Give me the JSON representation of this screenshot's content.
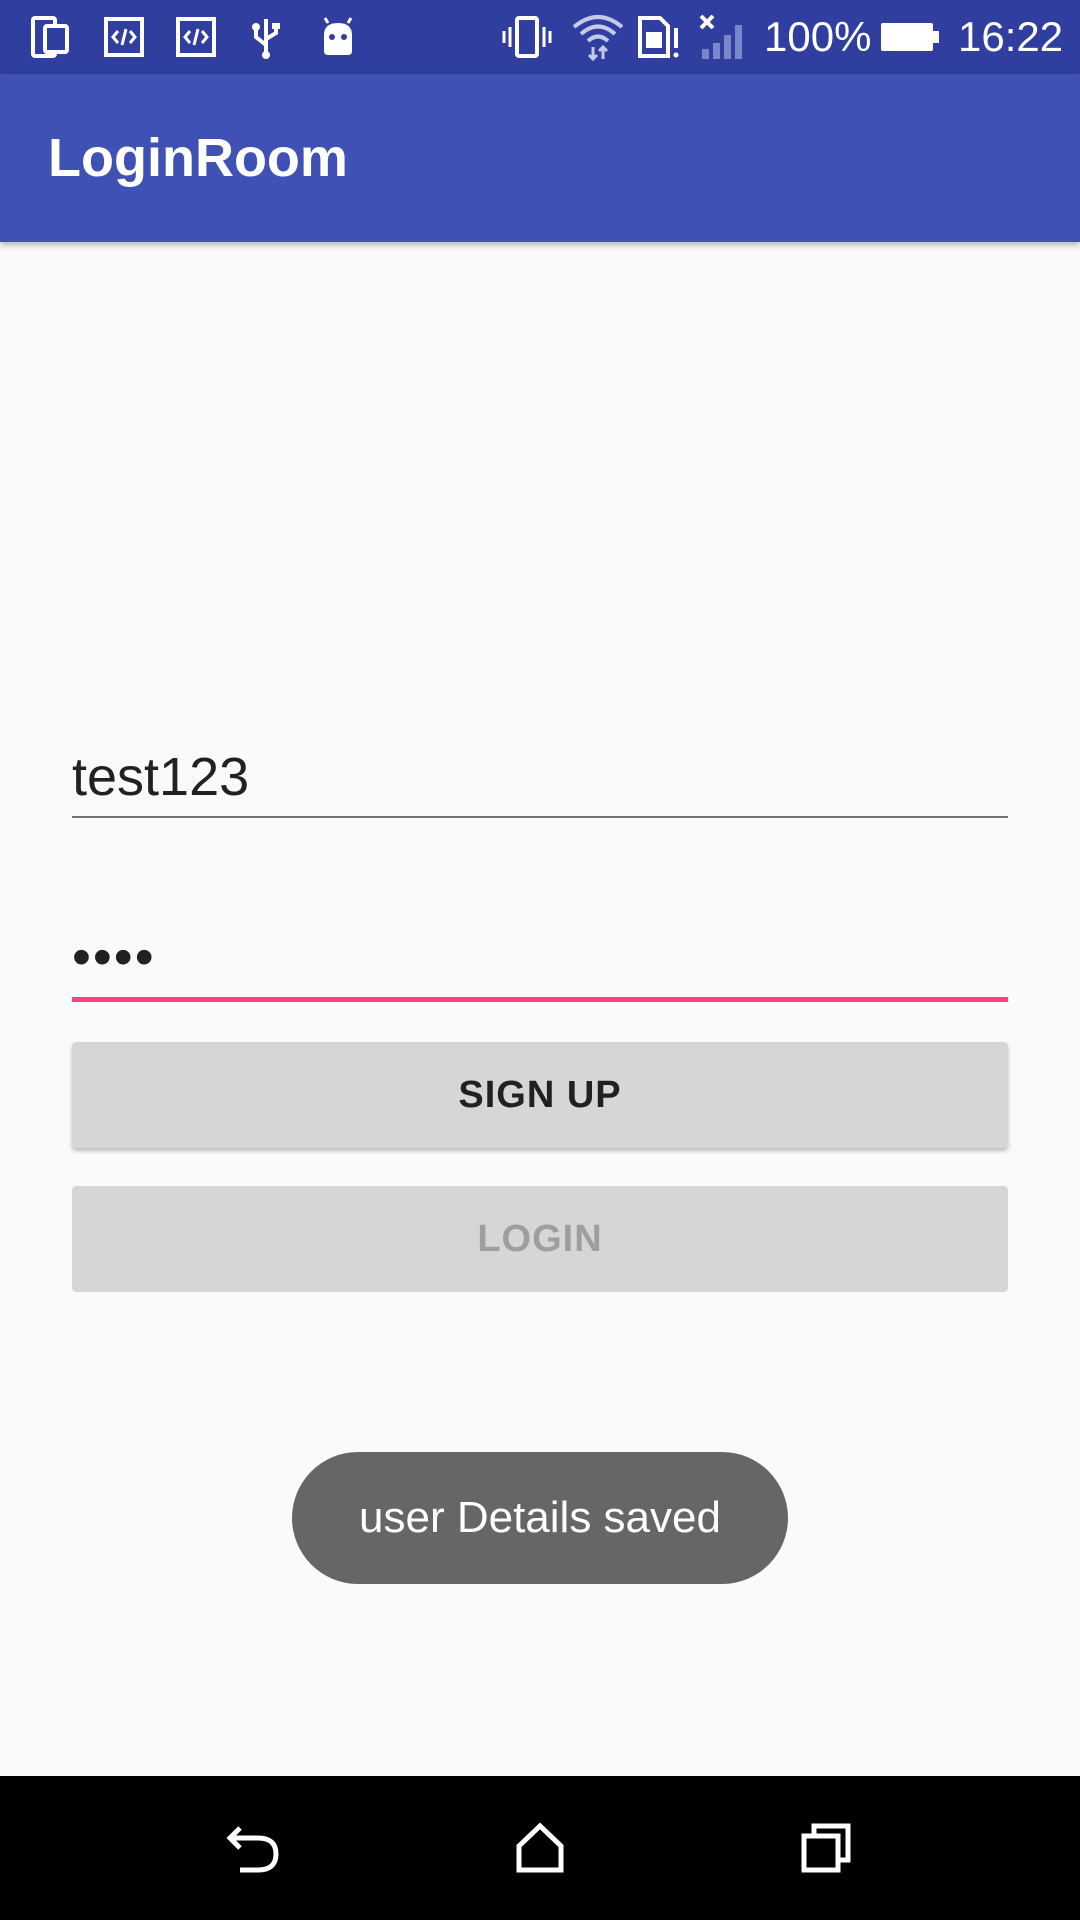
{
  "status_bar": {
    "battery_percent": "100%",
    "time": "16:22",
    "icons": [
      "phone-screen-icon",
      "code-icon",
      "code-icon",
      "usb-icon",
      "android-debug-icon",
      "vibrate-icon",
      "wifi-icon",
      "sim-alert-icon",
      "signal-icon",
      "battery-icon"
    ]
  },
  "app_bar": {
    "title": "LoginRoom"
  },
  "form": {
    "username_value": "test123",
    "password_value": "••••",
    "signup_label": "SIGN UP",
    "login_label": "LOGIN"
  },
  "toast": {
    "message": "user Details saved"
  },
  "nav_bar": {
    "icons": [
      "back-icon",
      "home-icon",
      "recents-icon"
    ]
  },
  "colors": {
    "status_bar": "#303f9f",
    "app_bar": "#3f51b5",
    "accent": "#ff4081",
    "button_bg": "#d6d6d6",
    "toast_bg": "#666666"
  }
}
